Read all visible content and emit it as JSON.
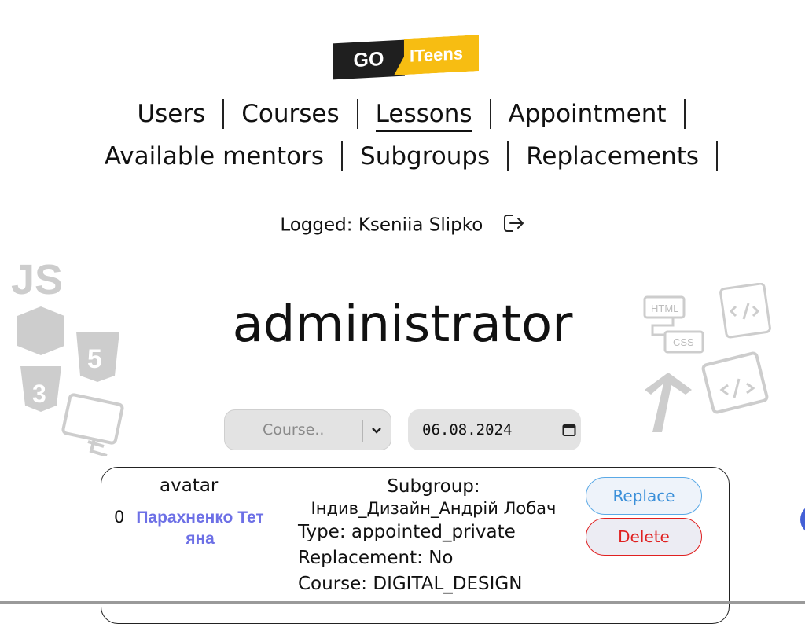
{
  "logo": {
    "left": "GO",
    "right": "ITeens"
  },
  "nav": {
    "row1": [
      "Users",
      "Courses",
      "Lessons",
      "Appointment"
    ],
    "row2": [
      "Available mentors",
      "Subgroups",
      "Replacements"
    ],
    "active": "Lessons"
  },
  "logged": {
    "text": "Logged: Kseniia Slipko",
    "icon": "logout-icon"
  },
  "role": "administrator",
  "filters": {
    "course_placeholder": "Course..",
    "date_value": "06.08.2024"
  },
  "lesson": {
    "avatar_label": "avatar",
    "index": "0",
    "mentor_line1": "Парахненко Тет",
    "mentor_line2": "яна",
    "subgroup_label": "Subgroup:",
    "subgroup_name": "Індив_Дизайн_Андрій Лобач",
    "type": "Type: appointed_private",
    "replacement": "Replacement: No",
    "course": "Course: DIGITAL_DESIGN",
    "replace_label": "Replace",
    "delete_label": "Delete"
  },
  "colors": {
    "accent": "#f7bd12",
    "mentor": "#6d70e6",
    "replace": "#3a8fd9",
    "delete": "#e02020"
  }
}
